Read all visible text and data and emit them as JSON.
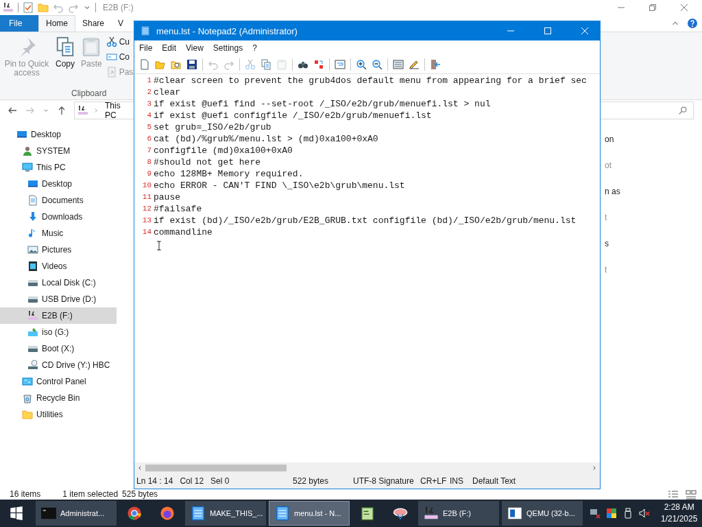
{
  "explorer": {
    "title": "E2B (F:)",
    "ribbon_tabs": [
      {
        "label": "File",
        "kind": "file",
        "selected": false
      },
      {
        "label": "Home",
        "kind": "tab",
        "selected": true
      },
      {
        "label": "Share",
        "kind": "tab",
        "selected": false
      },
      {
        "label": "V",
        "kind": "tab",
        "selected": false
      }
    ],
    "ribbon": {
      "large_buttons": [
        {
          "label": "Pin to Quick access",
          "kind": "pin",
          "disabled": true
        },
        {
          "label": "Copy",
          "kind": "copy",
          "disabled": false
        },
        {
          "label": "Paste",
          "kind": "paste",
          "disabled": true
        }
      ],
      "small_buttons": [
        {
          "label": "Cu",
          "kind": "cut",
          "disabled": false
        },
        {
          "label": "Co",
          "kind": "copypath",
          "disabled": false
        },
        {
          "label": "Pas",
          "kind": "shortcut",
          "disabled": true
        }
      ],
      "group": "Clipboard"
    },
    "address": {
      "location": "This PC"
    },
    "tree": [
      {
        "label": "Desktop",
        "kind": "desktop",
        "selected": false,
        "children": [
          {
            "label": "SYSTEM",
            "kind": "user",
            "selected": false
          },
          {
            "label": "This PC",
            "kind": "pc",
            "selected": false,
            "children": [
              {
                "label": "Desktop",
                "kind": "desktop",
                "selected": false
              },
              {
                "label": "Documents",
                "kind": "documents",
                "selected": false
              },
              {
                "label": "Downloads",
                "kind": "downloads",
                "selected": false
              },
              {
                "label": "Music",
                "kind": "music",
                "selected": false
              },
              {
                "label": "Pictures",
                "kind": "pictures",
                "selected": false
              },
              {
                "label": "Videos",
                "kind": "videos",
                "selected": false
              },
              {
                "label": "Local Disk (C:)",
                "kind": "drive",
                "selected": false
              },
              {
                "label": "USB Drive (D:)",
                "kind": "drive",
                "selected": false
              },
              {
                "label": "E2B (F:)",
                "kind": "e2b",
                "selected": true
              },
              {
                "label": "iso (G:)",
                "kind": "iso",
                "selected": false
              },
              {
                "label": "Boot (X:)",
                "kind": "drive",
                "selected": false
              },
              {
                "label": "CD Drive (Y:) HBC",
                "kind": "cd",
                "selected": false
              }
            ]
          },
          {
            "label": "Control Panel",
            "kind": "control",
            "selected": false
          },
          {
            "label": "Recycle Bin",
            "kind": "recycle",
            "selected": false
          },
          {
            "label": "Utilities",
            "kind": "folder",
            "selected": false
          }
        ]
      }
    ],
    "content_fragments": [
      {
        "text": "on",
        "disabled": false
      },
      {
        "text": "ot",
        "disabled": true
      },
      {
        "text": "n as",
        "disabled": false
      },
      {
        "text": "t",
        "disabled": true
      },
      {
        "text": "s",
        "disabled": false
      },
      {
        "text": "t",
        "disabled": true
      }
    ],
    "status": {
      "items": "16 items",
      "selection": "1 item selected",
      "size": "525 bytes"
    }
  },
  "notepad": {
    "title": "menu.lst - Notepad2 (Administrator)",
    "menu": [
      "File",
      "Edit",
      "View",
      "Settings",
      "?"
    ],
    "toolbar": [
      {
        "kind": "new",
        "disabled": false
      },
      {
        "kind": "open",
        "disabled": false
      },
      {
        "kind": "browse",
        "disabled": false
      },
      {
        "kind": "save",
        "disabled": false
      },
      {
        "kind": "sep"
      },
      {
        "kind": "undo",
        "disabled": true
      },
      {
        "kind": "redo",
        "disabled": true
      },
      {
        "kind": "sep"
      },
      {
        "kind": "cut",
        "disabled": true
      },
      {
        "kind": "copy",
        "disabled": false
      },
      {
        "kind": "paste",
        "disabled": true
      },
      {
        "kind": "sep"
      },
      {
        "kind": "find",
        "disabled": false
      },
      {
        "kind": "replace",
        "disabled": false
      },
      {
        "kind": "sep"
      },
      {
        "kind": "wrap",
        "disabled": false
      },
      {
        "kind": "sep"
      },
      {
        "kind": "zoomin",
        "disabled": false
      },
      {
        "kind": "zoomout",
        "disabled": false
      },
      {
        "kind": "sep"
      },
      {
        "kind": "scheme",
        "disabled": false
      },
      {
        "kind": "customize",
        "disabled": false
      },
      {
        "kind": "sep"
      },
      {
        "kind": "exit",
        "disabled": false
      }
    ],
    "lines": [
      {
        "number": "1",
        "text": "#clear screen to prevent the grub4dos default menu from appearing for a brief sec"
      },
      {
        "number": "2",
        "text": "clear"
      },
      {
        "number": "3",
        "text": "if exist @uefi find --set-root /_ISO/e2b/grub/menuefi.lst > nul"
      },
      {
        "number": "4",
        "text": "if exist @uefi configfile /_ISO/e2b/grub/menuefi.lst"
      },
      {
        "number": "5",
        "text": "set grub=_ISO/e2b/grub"
      },
      {
        "number": "6",
        "text": "cat (bd)/%grub%/menu.lst > (md)0xa100+0xA0"
      },
      {
        "number": "7",
        "text": "configfile (md)0xa100+0xA0"
      },
      {
        "number": "8",
        "text": "#should not get here"
      },
      {
        "number": "9",
        "text": "echo 128MB+ Memory required."
      },
      {
        "number": "10",
        "text": "echo ERROR - CAN'T FIND \\_ISO\\e2b\\grub\\menu.lst"
      },
      {
        "number": "11",
        "text": "pause"
      },
      {
        "number": "12",
        "text": "#failsafe"
      },
      {
        "number": "13",
        "text": "if exist (bd)/_ISO/e2b/grub/E2B_GRUB.txt configfile (bd)/_ISO/e2b/grub/menu.lst"
      },
      {
        "number": "14",
        "text": "commandline"
      }
    ],
    "status_groups": [
      [
        "Ln 14 : 14",
        "Col 12",
        "Sel 0"
      ],
      [
        "522 bytes"
      ],
      [
        "UTF-8 Signature"
      ],
      [
        "CR+LF"
      ],
      [
        "INS"
      ],
      [
        "Default Text"
      ]
    ]
  },
  "taskbar": {
    "items": [
      {
        "kind": "start",
        "running": false,
        "selected": false
      },
      {
        "kind": "console",
        "label": "Administrat...",
        "running": true,
        "selected": false
      },
      {
        "kind": "chrome",
        "running": false,
        "selected": false
      },
      {
        "kind": "firefox",
        "running": false,
        "selected": false
      },
      {
        "kind": "notepad",
        "label": "MAKE_THIS_...",
        "running": true,
        "selected": false
      },
      {
        "kind": "notepad",
        "label": "menu.lst - N...",
        "running": true,
        "selected": true
      },
      {
        "kind": "editor",
        "running": false,
        "selected": false
      },
      {
        "kind": "tool",
        "running": false,
        "selected": false
      },
      {
        "kind": "e2b",
        "label": "E2B (F:)",
        "running": true,
        "selected": false
      },
      {
        "kind": "qemu",
        "label": "QEMU (32-b...",
        "running": true,
        "selected": false
      }
    ],
    "time": "2:28 AM",
    "date": "1/21/2025"
  }
}
